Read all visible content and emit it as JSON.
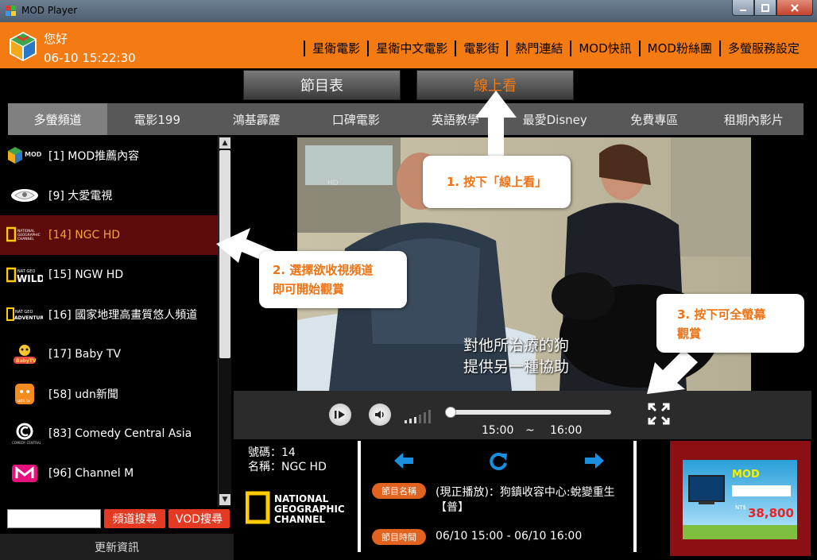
{
  "window": {
    "title": "MOD Player"
  },
  "header": {
    "greeting": "您好",
    "datetime": "06-10 15:22:30",
    "nav": [
      "星衛電影",
      "星衛中文電影",
      "電影街",
      "熱門連結",
      "MOD快訊",
      "MOD粉絲團",
      "多螢服務設定"
    ]
  },
  "buttons": {
    "schedule": "節目表",
    "watch_online": "線上看"
  },
  "categories": [
    "多螢頻道",
    "電影199",
    "鴻基霹靂",
    "口碑電影",
    "英語教學",
    "最愛Disney",
    "免費專區",
    "租期內影片"
  ],
  "channels": [
    {
      "name": "[1] MOD推薦內容",
      "logo_text": "MOD"
    },
    {
      "name": "[9] 大愛電視",
      "logo_text": ""
    },
    {
      "name": "[14] NGC HD",
      "logo_text": "NATIONAL GEOGRAPHIC CHANNEL"
    },
    {
      "name": "[15] NGW HD",
      "logo_text": "NAT GEO WILD"
    },
    {
      "name": "[16] 國家地理高畫質悠人頻道",
      "logo_text": "NAT GEO ADVENTURE"
    },
    {
      "name": "[17] Baby TV",
      "logo_text": "BabyTV"
    },
    {
      "name": "[58] udn新聞",
      "logo_text": "udn tv"
    },
    {
      "name": "[83] Comedy Central Asia",
      "logo_text": "COMEDY CENTRAL"
    },
    {
      "name": "[96] Channel M",
      "logo_text": ""
    }
  ],
  "search": {
    "channel_search": "頻道搜尋",
    "vod_search": "VOD搜尋",
    "update": "更新資訊"
  },
  "video": {
    "subtitle_line1": "對他所治療的狗",
    "subtitle_line2": "提供另一種協助",
    "corner_tag": "HD"
  },
  "player": {
    "start_time": "15:00",
    "separator": "~",
    "end_time": "16:00"
  },
  "info": {
    "number_label": "號碼：14",
    "name_label": "名稱：NGC HD",
    "channel_logo": "NATIONAL GEOGRAPHIC CHANNEL",
    "program_name_tag": "節目名稱",
    "program_name": "(現正播放)：狗鎮收容中心:蛻變重生",
    "program_name_2": "【普】",
    "program_time_tag": "節目時間",
    "program_time": "06/10 15:00  -  06/10 16:00"
  },
  "ad": {
    "brand": "MOD",
    "price": "38,800"
  },
  "callouts": {
    "step1": "1. 按下「線上看」",
    "step2_line1": "2. 選擇欲收視頻道",
    "step2_line2": "即可開始觀賞",
    "step3_line1": "3. 按下可全螢幕",
    "step3_line2": "觀賞"
  },
  "colors": {
    "accent": "#f47a12",
    "selected_row": "#5c0a0a",
    "button_red": "#e33a24"
  }
}
